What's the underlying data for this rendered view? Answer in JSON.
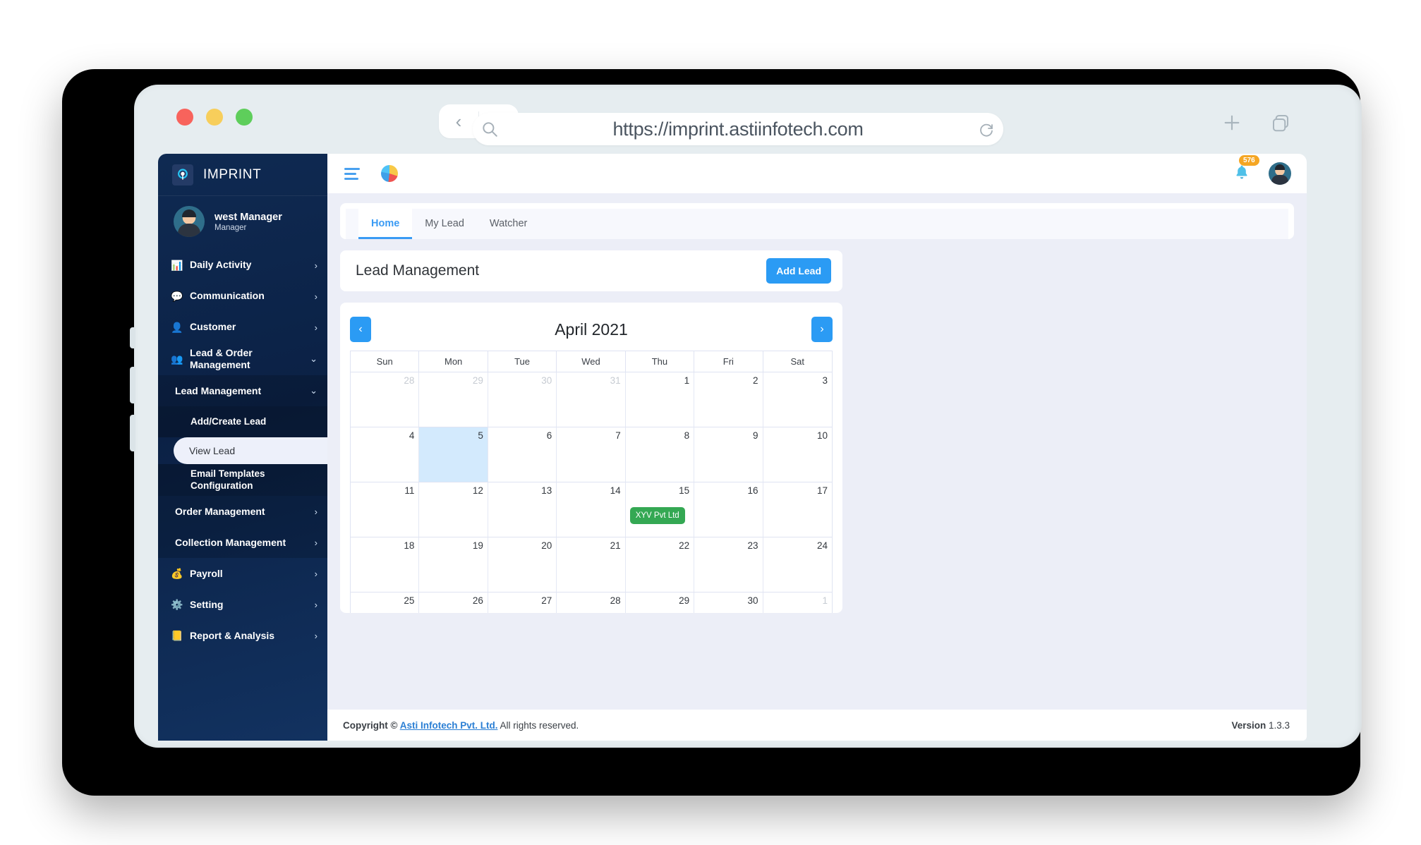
{
  "browser": {
    "url": "https://imprint.astiinfotech.com",
    "back_label": "‹",
    "forward_label": "›",
    "reload_icon": "reload-icon",
    "search_icon": "search-icon",
    "new_tab_icon": "plus-icon",
    "tabs_icon": "copy-tabs-icon"
  },
  "sidebar": {
    "brand": "IMPRINT",
    "brand_logo_icon": "imprint-logo-icon",
    "profile": {
      "name": "west Manager",
      "role": "Manager"
    },
    "items": [
      {
        "label": "Daily Activity",
        "icon": "📊",
        "arrow": "›",
        "type": "top"
      },
      {
        "label": "Communication",
        "icon": "💬",
        "arrow": "›",
        "type": "top"
      },
      {
        "label": "Customer",
        "icon": "👤",
        "arrow": "›",
        "type": "top"
      },
      {
        "label": "Lead & Order Management",
        "icon": "👥",
        "arrow": "⌄",
        "type": "top"
      },
      {
        "label": "Lead Management",
        "icon": "",
        "arrow": "⌄",
        "type": "sub"
      },
      {
        "label": "Add/Create Lead",
        "icon": "",
        "arrow": "",
        "type": "sub2"
      },
      {
        "label": "View Lead",
        "icon": "",
        "arrow": "",
        "type": "active"
      },
      {
        "label": "Email Templates Configuration",
        "icon": "",
        "arrow": "",
        "type": "sub2"
      },
      {
        "label": "Order Management",
        "icon": "",
        "arrow": "›",
        "type": "sub"
      },
      {
        "label": "Collection Management",
        "icon": "",
        "arrow": "›",
        "type": "sub"
      },
      {
        "label": "Payroll",
        "icon": "💰",
        "arrow": "›",
        "type": "top"
      },
      {
        "label": "Setting",
        "icon": "⚙️",
        "arrow": "›",
        "type": "top"
      },
      {
        "label": "Report & Analysis",
        "icon": "📒",
        "arrow": "›",
        "type": "top"
      }
    ]
  },
  "topbar": {
    "menu_icon": "hamburger-icon",
    "dashboard_icon": "pie-chart-icon",
    "bell_icon": "bell-icon",
    "notification_count": "576",
    "avatar_icon": "user-avatar"
  },
  "tabs": [
    {
      "label": "Home",
      "active": true
    },
    {
      "label": "My Lead",
      "active": false
    },
    {
      "label": "Watcher",
      "active": false
    }
  ],
  "page": {
    "title": "Lead Management",
    "add_lead_label": "Add Lead"
  },
  "calendar": {
    "title": "April 2021",
    "prev_label": "‹",
    "next_label": "›",
    "weekdays": [
      "Sun",
      "Mon",
      "Tue",
      "Wed",
      "Thu",
      "Fri",
      "Sat"
    ],
    "weeks": [
      [
        {
          "day": "28",
          "other": true
        },
        {
          "day": "29",
          "other": true
        },
        {
          "day": "30",
          "other": true
        },
        {
          "day": "31",
          "other": true
        },
        {
          "day": "1"
        },
        {
          "day": "2"
        },
        {
          "day": "3"
        }
      ],
      [
        {
          "day": "4"
        },
        {
          "day": "5",
          "today": true
        },
        {
          "day": "6"
        },
        {
          "day": "7"
        },
        {
          "day": "8"
        },
        {
          "day": "9"
        },
        {
          "day": "10"
        }
      ],
      [
        {
          "day": "11"
        },
        {
          "day": "12"
        },
        {
          "day": "13"
        },
        {
          "day": "14"
        },
        {
          "day": "15",
          "event": "XYV Pvt Ltd"
        },
        {
          "day": "16"
        },
        {
          "day": "17"
        }
      ],
      [
        {
          "day": "18"
        },
        {
          "day": "19"
        },
        {
          "day": "20"
        },
        {
          "day": "21"
        },
        {
          "day": "22"
        },
        {
          "day": "23"
        },
        {
          "day": "24"
        }
      ],
      [
        {
          "day": "25"
        },
        {
          "day": "26"
        },
        {
          "day": "27"
        },
        {
          "day": "28"
        },
        {
          "day": "29"
        },
        {
          "day": "30"
        },
        {
          "day": "1",
          "other": true
        }
      ]
    ],
    "event_color": "#34a853",
    "today_color": "#d3eafd"
  },
  "footer": {
    "copyright_prefix": "Copyright © ",
    "company": "Asti Infotech Pvt. Ltd.",
    "rights": " All rights reserved.",
    "version_label": "Version ",
    "version_value": "1.3.3"
  },
  "colors": {
    "accent": "#2b9bf4",
    "sidebar_dark": "#0b2145",
    "badge_orange": "#f5a623",
    "event_green": "#34a853"
  }
}
